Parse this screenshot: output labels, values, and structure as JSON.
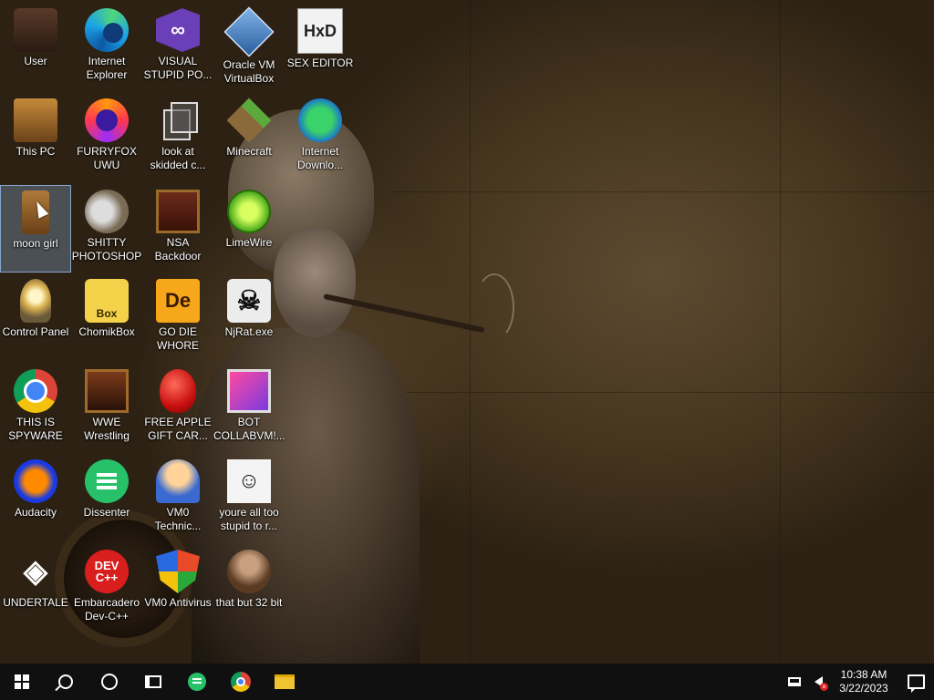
{
  "desktop": {
    "icons": [
      {
        "label": "User",
        "icon": "user-folder-icon"
      },
      {
        "label": "Internet\nExplorer",
        "icon": "edge-icon"
      },
      {
        "label": "VISUAL\nSTUPID PO...",
        "icon": "visual-studio-icon"
      },
      {
        "label": "Oracle VM\nVirtualBox",
        "icon": "virtualbox-icon"
      },
      {
        "label": "SEX EDITOR",
        "icon": "hex-editor-icon",
        "glyph": "HxD"
      },
      {
        "label": "This PC",
        "icon": "this-pc-icon"
      },
      {
        "label": "FURRYFOX\nUWU",
        "icon": "firefox-icon"
      },
      {
        "label": "look at\nskidded c...",
        "icon": "copy-icon"
      },
      {
        "label": "Minecraft",
        "icon": "minecraft-icon"
      },
      {
        "label": "Internet\nDownlo...",
        "icon": "download-manager-icon"
      },
      {
        "label": "moon girl",
        "icon": "book-icon"
      },
      {
        "label": "SHITTY\nPHOTOSHOP",
        "icon": "gimp-icon"
      },
      {
        "label": "NSA\nBackdoor",
        "icon": "nsa-icon"
      },
      {
        "label": "LimeWire",
        "icon": "limewire-icon"
      },
      {
        "label": "Control Panel",
        "icon": "control-panel-icon"
      },
      {
        "label": "ChomikBox",
        "icon": "chomikbox-icon",
        "glyph": "Box"
      },
      {
        "label": "GO DIE\nWHORE",
        "icon": "de-icon",
        "glyph": "De"
      },
      {
        "label": "NjRat.exe",
        "icon": "skull-icon",
        "glyph": "☠"
      },
      {
        "label": "THIS IS\nSPYWARE",
        "icon": "chrome-icon"
      },
      {
        "label": "WWE\nWrestling",
        "icon": "wwe-icon"
      },
      {
        "label": "FREE APPLE\nGIFT CAR...",
        "icon": "apple-icon"
      },
      {
        "label": "BOT\nCOLLABVM!...",
        "icon": "bot-icon"
      },
      {
        "label": "Audacity",
        "icon": "audacity-icon"
      },
      {
        "label": "Dissenter",
        "icon": "dissenter-icon"
      },
      {
        "label": "VM0\nTechnic...",
        "icon": "technician-icon"
      },
      {
        "label": "youre all too\nstupid to r...",
        "icon": "portrait-icon"
      },
      {
        "label": "UNDERTALE",
        "icon": "unity-icon",
        "glyph": "◈"
      },
      {
        "label": "Embarcadero\nDev-C++",
        "icon": "devcpp-icon",
        "glyph": "DEV\nC++"
      },
      {
        "label": "VM0 Antivirus",
        "icon": "shield-icon"
      },
      {
        "label": "that but 32 bit",
        "icon": "woman-portrait-icon"
      }
    ]
  },
  "taskbar": {
    "pinned": [
      "windows-start-icon",
      "search-icon",
      "cortana-icon",
      "task-view-icon",
      "dissenter-icon",
      "chrome-icon",
      "file-explorer-icon"
    ],
    "clock": {
      "time": "10:38 AM",
      "date": "3/22/2023"
    }
  },
  "colors": {
    "taskbar": "#101010",
    "selection": "#99ccff"
  }
}
